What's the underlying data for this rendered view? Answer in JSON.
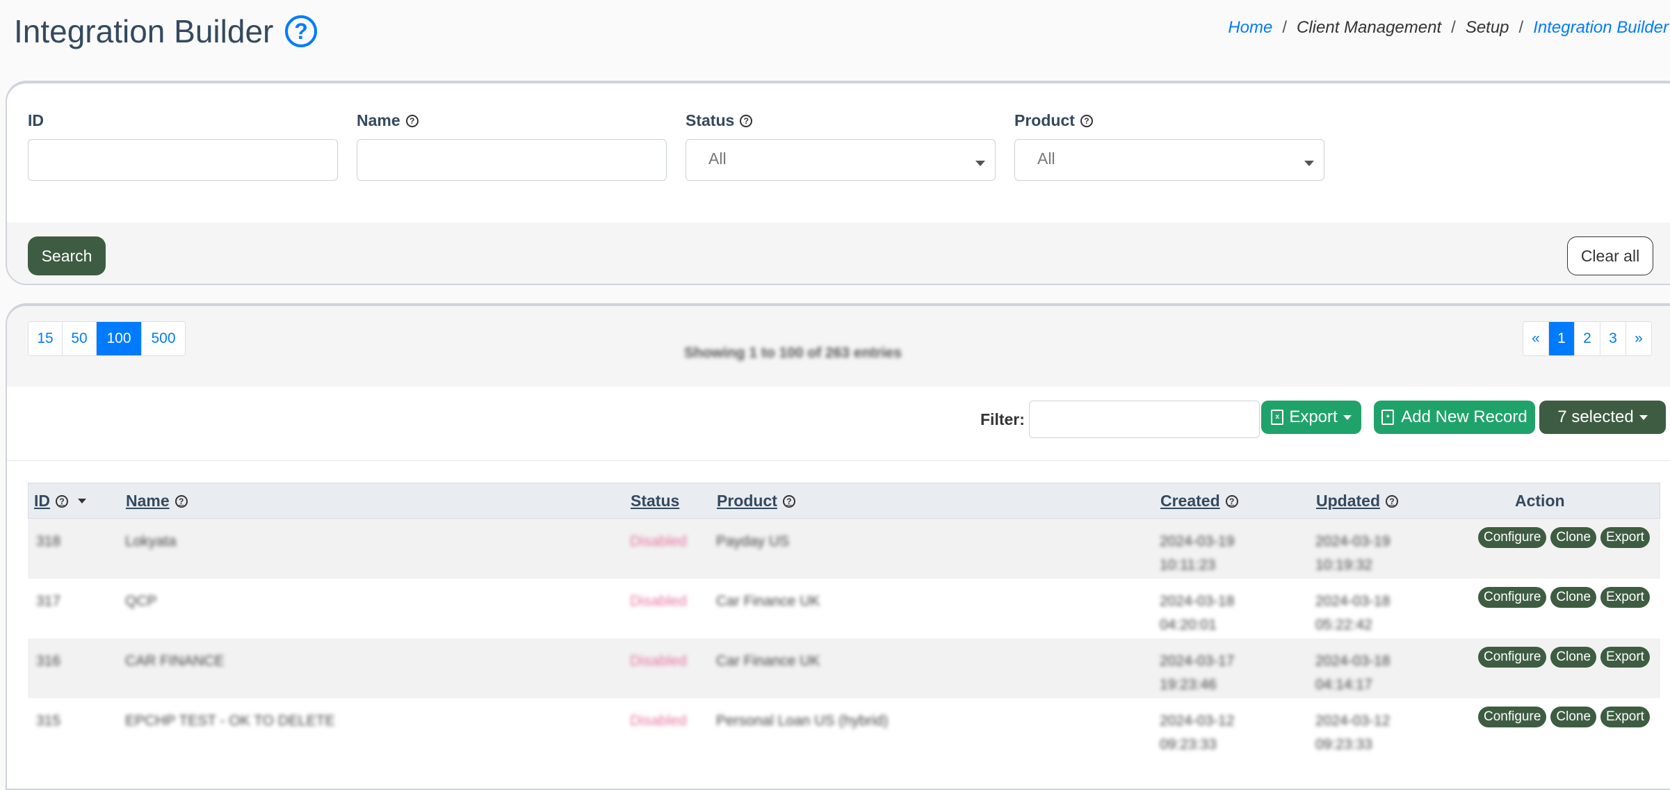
{
  "header": {
    "title": "Integration Builder",
    "help_icon": "question-circle-icon",
    "breadcrumb": {
      "home": "Home",
      "client_management": "Client Management",
      "setup": "Setup",
      "current": "Integration Builder"
    },
    "accent_color": "#007bff"
  },
  "filters": {
    "id_label": "ID",
    "id_value": "",
    "name_label": "Name",
    "name_value": "",
    "status_label": "Status",
    "status_value": "All",
    "product_label": "Product",
    "product_value": "All",
    "search_button": "Search",
    "clear_button": "Clear all"
  },
  "table_controls": {
    "page_sizes": [
      "15",
      "50",
      "100",
      "500"
    ],
    "active_page_size": "100",
    "showing_text": "Showing 1 to 100 of 263 entries",
    "pagination": {
      "prev": "«",
      "pages": [
        "1",
        "2",
        "3"
      ],
      "active": "1",
      "next": "»"
    },
    "filter_label": "Filter:",
    "filter_value": "",
    "export_button": "Export",
    "add_button": "Add New Record",
    "selected_button": "7 selected"
  },
  "table": {
    "columns": {
      "id": "ID",
      "name": "Name",
      "status": "Status",
      "product": "Product",
      "created": "Created",
      "updated": "Updated",
      "action": "Action"
    },
    "rows": [
      {
        "id": "318",
        "name": "Lokyata",
        "status": "Disabled",
        "product": "Payday US",
        "created_date": "2024-03-19",
        "created_time": "10:11:23",
        "updated_date": "2024-03-19",
        "updated_time": "10:19:32"
      },
      {
        "id": "317",
        "name": "QCP",
        "status": "Disabled",
        "product": "Car Finance UK",
        "created_date": "2024-03-18",
        "created_time": "04:20:01",
        "updated_date": "2024-03-18",
        "updated_time": "05:22:42"
      },
      {
        "id": "316",
        "name": "CAR FINANCE",
        "status": "Disabled",
        "product": "Car Finance UK",
        "created_date": "2024-03-17",
        "created_time": "19:23:46",
        "updated_date": "2024-03-18",
        "updated_time": "04:14:17"
      },
      {
        "id": "315",
        "name": "EPCHP TEST - OK TO DELETE",
        "status": "Disabled",
        "product": "Personal Loan US (hybrid)",
        "created_date": "2024-03-12",
        "created_time": "09:23:33",
        "updated_date": "2024-03-12",
        "updated_time": "09:23:33"
      }
    ],
    "actions": {
      "configure": "Configure",
      "clone": "Clone",
      "export": "Export"
    }
  }
}
